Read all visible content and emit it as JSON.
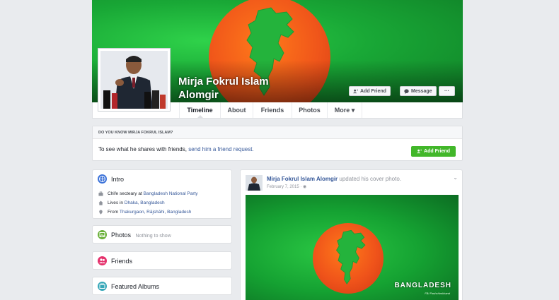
{
  "profile": {
    "name": "Mirja Fokrul Islam Alomgir",
    "add_friend_label": "Add Friend",
    "message_label": "Message",
    "more_dots": "···"
  },
  "nav": {
    "tabs": [
      {
        "label": "Timeline"
      },
      {
        "label": "About"
      },
      {
        "label": "Friends"
      },
      {
        "label": "Photos"
      },
      {
        "label": "More ▾"
      }
    ]
  },
  "know_card": {
    "heading": "DO YOU KNOW MIRJA FOKRUL ISLAM?",
    "text_prefix": "To see what he shares with friends,",
    "text_link": "send him a friend request.",
    "button_label": "Add Friend"
  },
  "intro": {
    "title": "Intro",
    "rows": [
      {
        "icon": "briefcase-icon",
        "prefix": "Chife secteary at",
        "link": "Bangladesh National Party"
      },
      {
        "icon": "home-icon",
        "prefix": "Lives in",
        "link": "Dhaka, Bangladesh"
      },
      {
        "icon": "location-pin-icon",
        "prefix": "From",
        "link": "Thakurgaon, Rājshāhi, Bangladesh"
      }
    ]
  },
  "photos_card": {
    "title": "Photos",
    "note": "Nothing to show"
  },
  "friends_card": {
    "title": "Friends"
  },
  "albums_card": {
    "title": "Featured Albums"
  },
  "post": {
    "author": "Mirja Fokrul Islam Alomgir",
    "action": "updated his cover photo.",
    "date": "February 7, 2015 · ",
    "photo_brand": "BANGLADESH",
    "photo_brand_sub": "FB/ Pashchimkhand"
  },
  "colors": {
    "facebook_blue": "#365899",
    "add_friend_green": "#42b72a",
    "flag_green": "#19a836",
    "flag_red_orange": "#f0561a"
  }
}
